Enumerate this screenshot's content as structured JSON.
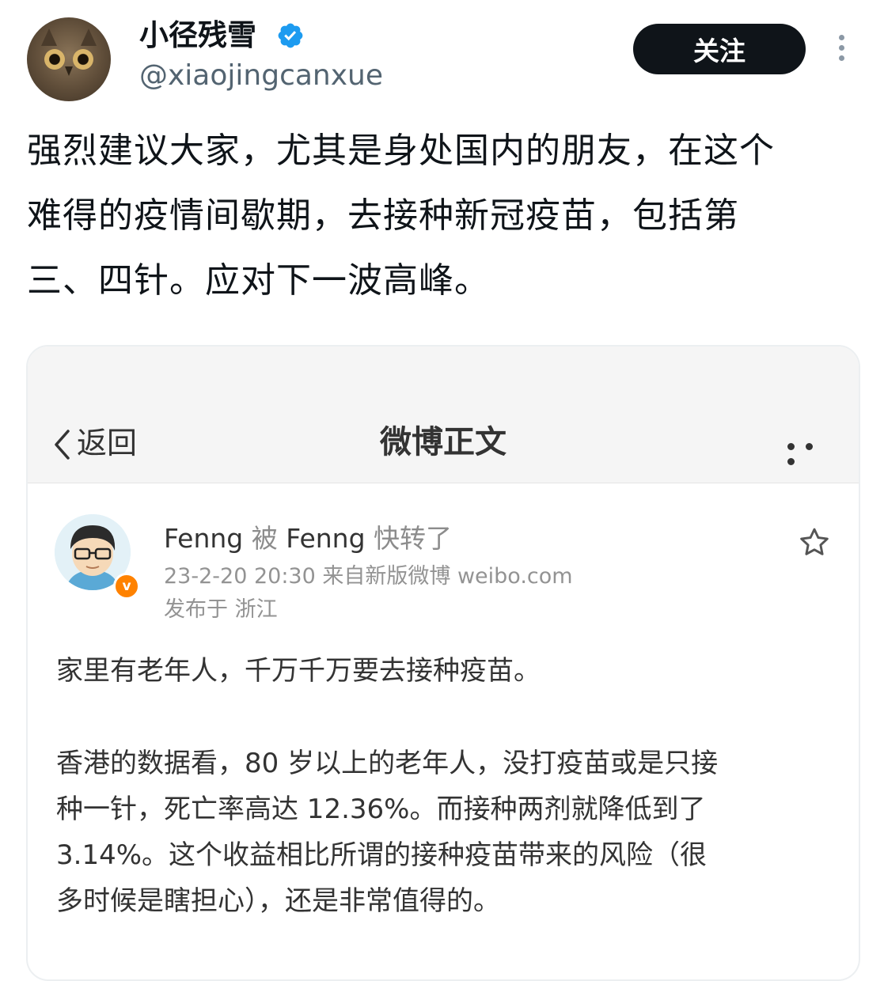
{
  "tweet": {
    "display_name": "小径残雪",
    "handle": "@xiaojingcanxue",
    "follow_label": "关注",
    "text_lines": [
      "强烈建议大家，尤其是身处国内的朋友，在这个",
      "难得的疫情间歇期，去接种新冠疫苗，包括第",
      "三、四针。应对下一波高峰。"
    ]
  },
  "weibo": {
    "nav": {
      "back_label": "返回",
      "title": "微博正文"
    },
    "post": {
      "author": "Fenng",
      "repost_word": "被",
      "reposter": "Fenng",
      "repost_suffix": "快转了",
      "timestamp": "23-2-20 20:30",
      "source": "来自新版微博 weibo.com",
      "location": "发布于 浙江",
      "badge": "v",
      "paragraph_1": "家里有老年人，千万千万要去接种疫苗。",
      "paragraph_2_lines": [
        "香港的数据看，80 岁以上的老年人，没打疫苗或是只接",
        "种一针，死亡率高达 12.36%。而接种两剂就降低到了",
        "3.14%。这个收益相比所谓的接种疫苗带来的风险（很",
        "多时候是瞎担心），还是非常值得的。"
      ]
    }
  },
  "colors": {
    "follow_button_bg": "#0f1419",
    "verified_blue": "#1d9bf0",
    "weibo_badge_orange": "#ff8200",
    "meta_grey": "#939393"
  },
  "icons": [
    "verified-badge-icon",
    "more-vertical-icon",
    "back-chevron-icon",
    "more-horizontal-icon",
    "star-icon"
  ]
}
